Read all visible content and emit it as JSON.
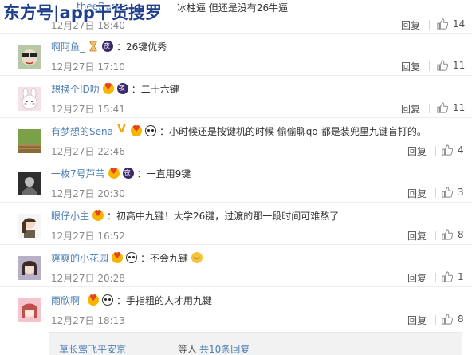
{
  "watermark": "东方号|app干货搜罗",
  "top_fragment": {
    "name": "theeDuran",
    "text": "冰柱逼 但还是没有26牛逼",
    "time": "12月27日 18:40",
    "reply": "回复",
    "likes": "14"
  },
  "comments": [
    {
      "user": "啊阿鱼_",
      "badges": [
        "hourglass",
        "night"
      ],
      "text": "26键优秀",
      "time": "12月27日 17:10",
      "reply": "回复",
      "likes": "11"
    },
    {
      "user": "想换个ID叻",
      "badges": [
        "heart",
        "night"
      ],
      "text": "二十六键",
      "time": "12月27日 15:41",
      "reply": "回复",
      "likes": "11"
    },
    {
      "user": "有梦想的Sena",
      "badges": [
        "vip",
        "heart",
        "panda"
      ],
      "text": "小时候还是按键机的时候 偷偷聊qq 都是装兜里九键盲打的。",
      "time": "12月27日 22:46",
      "reply": "回复",
      "likes": "4"
    },
    {
      "user": "一枚7号芦苇",
      "badges": [
        "heart",
        "night"
      ],
      "text": "一直用9键",
      "time": "12月27日 20:30",
      "reply": "回复",
      "likes": "3"
    },
    {
      "user": "眼仔小主",
      "badges": [
        "heart"
      ],
      "text": "初高中九键！大学26键，过渡的那一段时间可难熬了",
      "time": "12月27日 16:52",
      "reply": "回复",
      "likes": "8"
    },
    {
      "user": "爽爽的小花园",
      "badges": [
        "heart",
        "panda"
      ],
      "text": "不会九键",
      "trailing_emoji": "laugh",
      "time": "12月27日 20:28",
      "reply": "回复",
      "likes": "1"
    },
    {
      "user": "雨欣啊_",
      "badges": [
        "heart",
        "panda"
      ],
      "text": "手指粗的人才用九键",
      "time": "12月27日 18:13",
      "reply": "回复",
      "likes": "8"
    }
  ],
  "more": {
    "users": "草长莺飞平安京",
    "etc": "等人",
    "link": "共10条回复"
  },
  "icons": {
    "like": "thumbs-up-icon"
  },
  "colors": {
    "link_blue": "#4e7fb5",
    "meta_gray": "#888888",
    "divider": "#eeeeee"
  }
}
